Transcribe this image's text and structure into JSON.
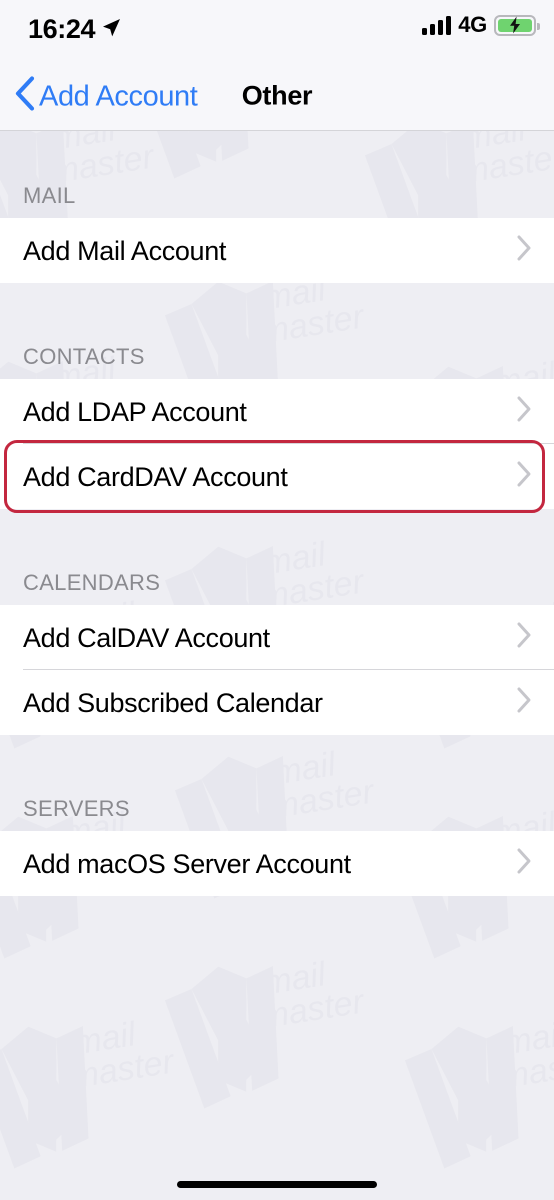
{
  "status_bar": {
    "time": "16:24",
    "location_icon": "location-arrow-icon",
    "signal_icon": "cellular-signal-bars-icon",
    "carrier": "4G",
    "battery_icon": "battery-charging-icon",
    "battery_color": "#6fd36f"
  },
  "nav": {
    "back_icon": "chevron-left-icon",
    "back_label": "Add Account",
    "title": "Other",
    "accent_color": "#2f7cf6"
  },
  "sections": [
    {
      "header": "MAIL",
      "rows": [
        {
          "label": "Add Mail Account",
          "accessory_icon": "chevron-right-icon",
          "highlighted": false
        }
      ]
    },
    {
      "header": "CONTACTS",
      "rows": [
        {
          "label": "Add LDAP Account",
          "accessory_icon": "chevron-right-icon",
          "highlighted": false
        },
        {
          "label": "Add CardDAV Account",
          "accessory_icon": "chevron-right-icon",
          "highlighted": true
        }
      ]
    },
    {
      "header": "CALENDARS",
      "rows": [
        {
          "label": "Add CalDAV Account",
          "accessory_icon": "chevron-right-icon",
          "highlighted": false
        },
        {
          "label": "Add Subscribed Calendar",
          "accessory_icon": "chevron-right-icon",
          "highlighted": false
        }
      ]
    },
    {
      "header": "SERVERS",
      "rows": [
        {
          "label": "Add macOS Server Account",
          "accessory_icon": "chevron-right-icon",
          "highlighted": false
        }
      ]
    }
  ],
  "highlight": {
    "color": "#c3273f",
    "target_row_label": "Add CardDAV Account"
  },
  "watermark": {
    "text_line1": "mail",
    "text_line2": "master",
    "color": "#e3e3ea"
  },
  "home_indicator": {
    "icon": "home-indicator-bar"
  }
}
